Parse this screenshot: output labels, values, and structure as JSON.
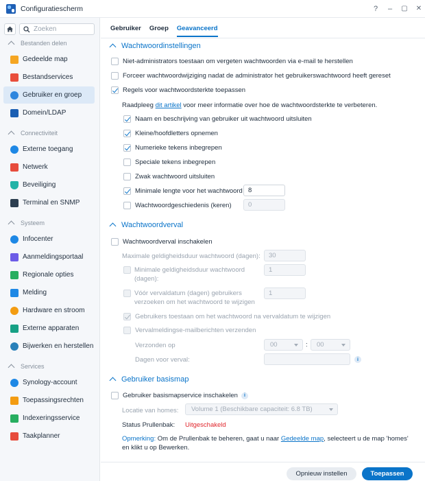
{
  "window": {
    "title": "Configuratiescherm",
    "help": "?",
    "minimize": "–",
    "maximize": "▢",
    "close": "✕"
  },
  "sidebar": {
    "search_placeholder": "Zoeken",
    "sections": [
      {
        "label": "Bestanden delen"
      },
      {
        "label": "Connectiviteit"
      },
      {
        "label": "Systeem"
      },
      {
        "label": "Services"
      }
    ],
    "items": [
      {
        "label": "Gedeelde map"
      },
      {
        "label": "Bestandservices"
      },
      {
        "label": "Gebruiker en groep"
      },
      {
        "label": "Domein/LDAP"
      },
      {
        "label": "Externe toegang"
      },
      {
        "label": "Netwerk"
      },
      {
        "label": "Beveiliging"
      },
      {
        "label": "Terminal en SNMP"
      },
      {
        "label": "Infocenter"
      },
      {
        "label": "Aanmeldingsportaal"
      },
      {
        "label": "Regionale opties"
      },
      {
        "label": "Melding"
      },
      {
        "label": "Hardware en stroom"
      },
      {
        "label": "Externe apparaten"
      },
      {
        "label": "Bijwerken en herstellen"
      },
      {
        "label": "Synology-account"
      },
      {
        "label": "Toepassingsrechten"
      },
      {
        "label": "Indexeringsservice"
      },
      {
        "label": "Taakplanner"
      }
    ]
  },
  "tabs": [
    {
      "label": "Gebruiker"
    },
    {
      "label": "Groep"
    },
    {
      "label": "Geavanceerd"
    }
  ],
  "password_settings": {
    "title": "Wachtwoordinstellingen",
    "allow_reset": "Niet-administrators toestaan om vergeten wachtwoorden via e-mail te herstellen",
    "force_change": "Forceer wachtwoordwijziging nadat de administrator het gebruikerswachtwoord heeft gereset",
    "strength_rules": "Regels voor wachtwoordsterkte toepassen",
    "hint_prefix": "Raadpleeg ",
    "hint_link": "dit artikel",
    "hint_suffix": " voor meer informatie over hoe de wachtwoordsterkte te verbeteren.",
    "exclude_name": "Naam en beschrijving van gebruiker uit wachtwoord uitsluiten",
    "mixed_case": "Kleine/hoofdletters opnemen",
    "numeric": "Numerieke tekens inbegrepen",
    "special": "Speciale tekens inbegrepen",
    "exclude_weak": "Zwak wachtwoord uitsluiten",
    "min_length": "Minimale lengte voor het wachtwoord",
    "min_length_value": "8",
    "history": "Wachtwoordgeschiedenis (keren)",
    "history_value": "0"
  },
  "expiry": {
    "title": "Wachtwoordverval",
    "enable": "Wachtwoordverval inschakelen",
    "max_days": "Maximale geldigheidsduur wachtwoord (dagen):",
    "max_days_value": "30",
    "min_days": "Minimale geldigheidsduur wachtwoord (dagen):",
    "min_days_value": "1",
    "notify_before": "Vóór vervaldatum (dagen) gebruikers verzoeken om het wachtwoord te wijzigen",
    "notify_before_value": "1",
    "allow_after": "Gebruikers toestaan om het wachtwoord na vervaldatum te wijzigen",
    "send_mail": "Vervalmeldingse-mailberichten verzenden",
    "sent_on": "Verzonden op",
    "hour": "00",
    "minute": "00",
    "days_before": "Dagen voor verval:",
    "days_before_value": ""
  },
  "home": {
    "title": "Gebruiker basismap",
    "enable": "Gebruiker basismapservice inschakelen",
    "location_label": "Locatie van homes:",
    "location_value": "Volume 1 (Beschikbare capaciteit:  6.8 TB)",
    "recycle_label": "Status Prullenbak:",
    "recycle_value": "Uitgeschakeld",
    "note_label": "Opmerking:",
    "note_prefix": " Om de Prullenbak te beheren, gaat u naar ",
    "note_link": "Gedeelde map",
    "note_suffix": ", selecteert u de map 'homes' en klikt u op Bewerken."
  },
  "footer": {
    "reset": "Opnieuw instellen",
    "apply": "Toepassen"
  },
  "colors": {
    "accent": "#0a74c9",
    "disabled_status": "#e0262c"
  }
}
